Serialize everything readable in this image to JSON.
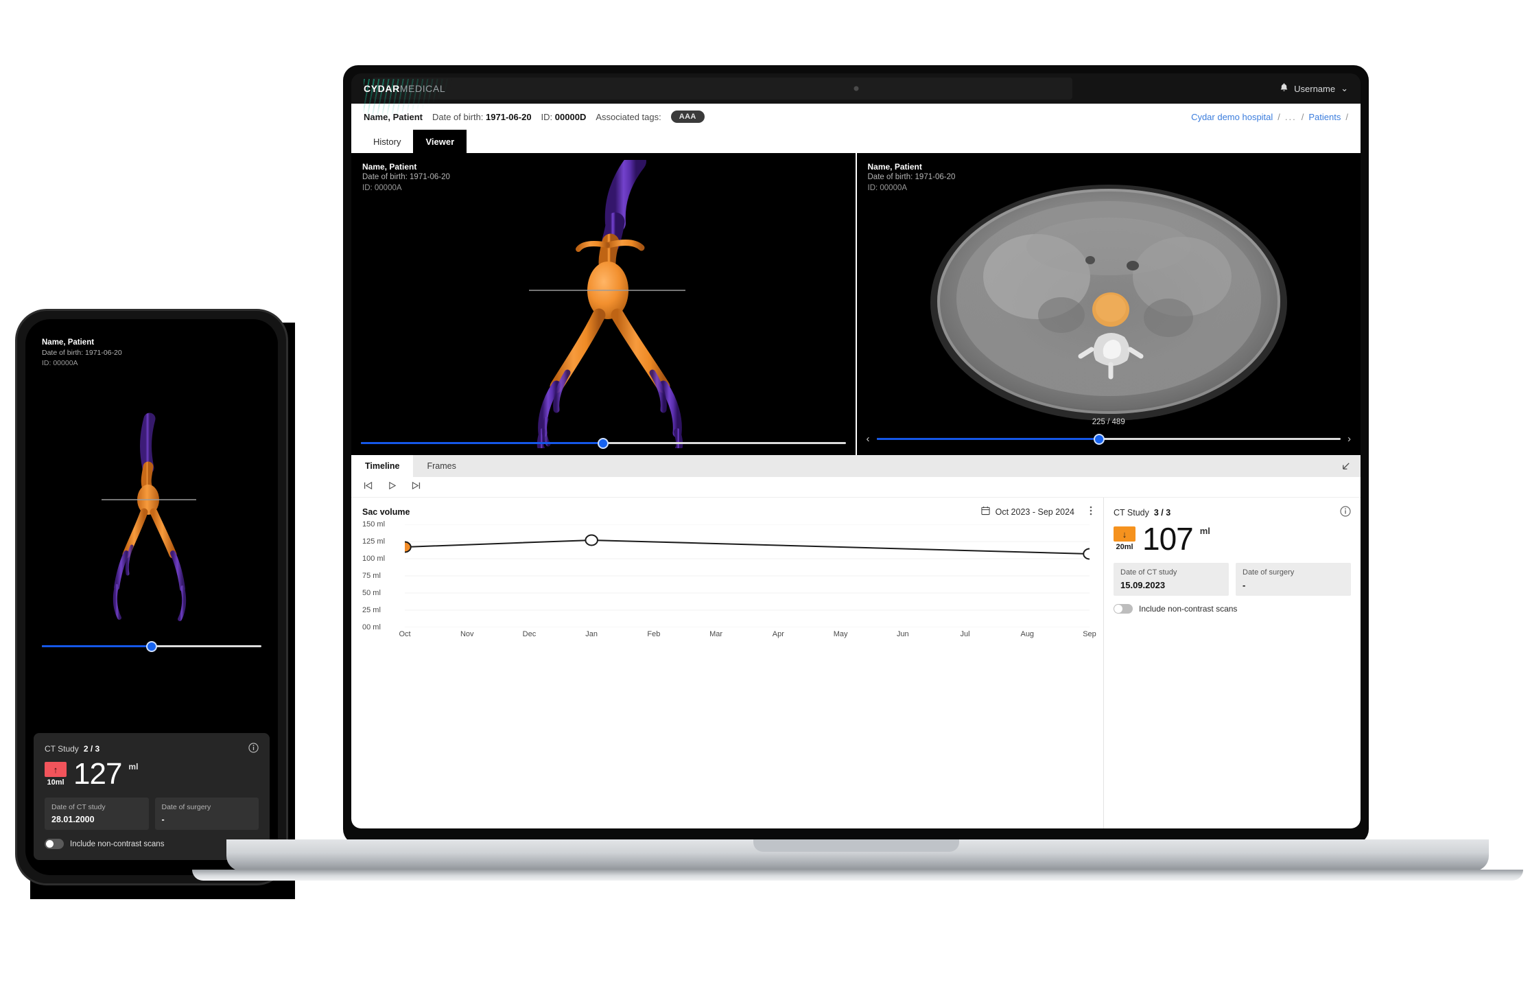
{
  "app": {
    "brand_bold": "CYDAR",
    "brand_light": "MEDICAL",
    "user": "Username",
    "chevron": "⌄",
    "bell_icon": "bell-icon"
  },
  "patient_header": {
    "name": "Name, Patient",
    "dob_label": "Date of birth:",
    "dob_value": "1971-06-20",
    "id_label": "ID:",
    "id_value": "00000D",
    "tags_label": "Associated tags:",
    "tag": "AAA"
  },
  "breadcrumb": {
    "hospital": "Cydar demo hospital",
    "sep": "/",
    "dots": "...",
    "patients": "Patients"
  },
  "tabs": [
    {
      "label": "History",
      "active": false
    },
    {
      "label": "Viewer",
      "active": true
    }
  ],
  "viewer_left": {
    "name": "Name, Patient",
    "dob": "Date of birth: 1971-06-20",
    "id": "ID: 00000A",
    "slider_percent": 50
  },
  "viewer_right": {
    "name": "Name, Patient",
    "dob": "Date of birth: 1971-06-20",
    "id": "ID: 00000A",
    "slice_counter": "225 / 489",
    "slider_percent": 48,
    "prev_icon": "chevron-left-icon",
    "next_icon": "chevron-right-icon"
  },
  "bottom_panel": {
    "tabs": [
      {
        "label": "Timeline",
        "active": true
      },
      {
        "label": "Frames",
        "active": false
      }
    ],
    "collapse_icon": "collapse-down-left-icon",
    "playback": {
      "first": "skip-to-first-icon",
      "play": "play-icon",
      "last": "skip-to-last-icon"
    }
  },
  "chart_data": {
    "type": "line",
    "title": "Sac volume",
    "date_range": "Oct 2023 - Sep 2024",
    "calendar_icon": "calendar-icon",
    "kebab_icon": "more-vertical-icon",
    "xlabel": "",
    "ylabel": "",
    "ylim": [
      0,
      150
    ],
    "yticks": [
      150,
      125,
      100,
      75,
      50,
      25,
      0
    ],
    "ytick_labels": [
      "150 ml",
      "125 ml",
      "100 ml",
      "75 ml",
      "50 ml",
      "25 ml",
      "00 ml"
    ],
    "categories": [
      "Oct",
      "Nov",
      "Dec",
      "Jan",
      "Feb",
      "Mar",
      "Apr",
      "May",
      "Jun",
      "Jul",
      "Aug",
      "Sep"
    ],
    "grid": true,
    "legend": "none",
    "series": [
      {
        "name": "Sac volume",
        "points": [
          {
            "x": "Oct",
            "y": 117,
            "selected": true
          },
          {
            "x": "Jan",
            "y": 127,
            "selected": false
          },
          {
            "x": "Sep",
            "y": 107,
            "selected": false
          }
        ]
      }
    ],
    "line_color": "#1a1a1a",
    "selected_color": "#f28c28"
  },
  "study_panel": {
    "label": "CT Study",
    "counter": "3 / 3",
    "info_icon": "info-icon",
    "delta_direction": "down",
    "delta_arrow": "↓",
    "delta_amount": "20ml",
    "delta_color": "#f5921e",
    "value": "107",
    "unit": "ml",
    "fields": [
      {
        "label": "Date of CT study",
        "value": "15.09.2023"
      },
      {
        "label": "Date of surgery",
        "value": "-"
      }
    ],
    "toggle_label": "Include non-contrast scans",
    "toggle_on": false
  },
  "phone": {
    "meta": {
      "name": "Name, Patient",
      "dob": "Date of birth: 1971-06-20",
      "id": "ID: 00000A"
    },
    "slider_percent": 50,
    "study": {
      "label": "CT Study",
      "counter": "2 / 3",
      "info_icon": "info-icon",
      "delta_arrow": "↑",
      "delta_amount": "10ml",
      "delta_color": "#f2545b",
      "value": "127",
      "unit": "ml",
      "fields": [
        {
          "label": "Date of CT study",
          "value": "28.01.2000"
        },
        {
          "label": "Date of surgery",
          "value": "-"
        }
      ],
      "toggle_label": "Include non-contrast scans",
      "toggle_on": false
    }
  },
  "colors": {
    "accent_blue": "#1763ef",
    "link_blue": "#3b7ddd",
    "aorta_orange": "#f08a2a",
    "vessel_purple": "#5c2fa8"
  }
}
